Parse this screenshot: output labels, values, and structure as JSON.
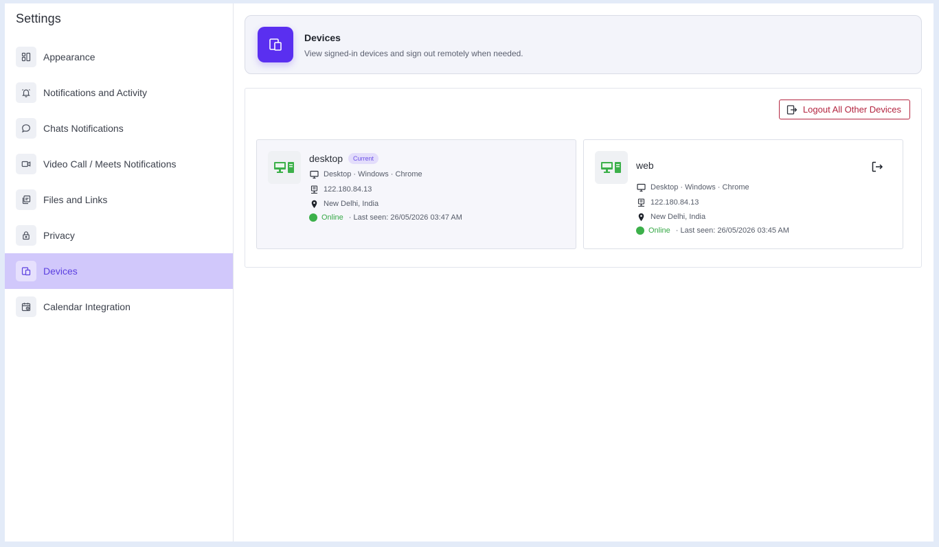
{
  "sidebar": {
    "title": "Settings",
    "items": [
      {
        "label": "Appearance",
        "icon": "layout-icon"
      },
      {
        "label": "Notifications and Activity",
        "icon": "bell-icon"
      },
      {
        "label": "Chats Notifications",
        "icon": "chat-bubble-icon"
      },
      {
        "label": "Video Call / Meets Notifications",
        "icon": "video-icon"
      },
      {
        "label": "Files and Links",
        "icon": "files-icon"
      },
      {
        "label": "Privacy",
        "icon": "lock-icon"
      },
      {
        "label": "Devices",
        "icon": "devices-icon",
        "active": true
      },
      {
        "label": "Calendar Integration",
        "icon": "calendar-icon"
      }
    ]
  },
  "header": {
    "title": "Devices",
    "subtitle": "View signed-in devices and sign out remotely when needed."
  },
  "panel": {
    "logout_all_label": "Logout All Other Devices"
  },
  "devices": [
    {
      "name": "desktop",
      "badge": "Current",
      "platform": "Desktop · Windows · Chrome",
      "ip": "122.180.84.13",
      "location": "New Delhi, India",
      "status": "Online",
      "last_seen": "· Last seen: 26/05/2026 03:47 AM"
    },
    {
      "name": "web",
      "platform": "Desktop · Windows · Chrome",
      "ip": "122.180.84.13",
      "location": "New Delhi, India",
      "status": "Online",
      "last_seen": "· Last seen: 26/05/2026 03:45 AM"
    }
  ],
  "colors": {
    "accent": "#5a2ff0",
    "active_nav_bg": "#d1c8fb",
    "danger": "#b3243f",
    "online": "#3cb04a",
    "device_icon": "#3cb04a"
  }
}
